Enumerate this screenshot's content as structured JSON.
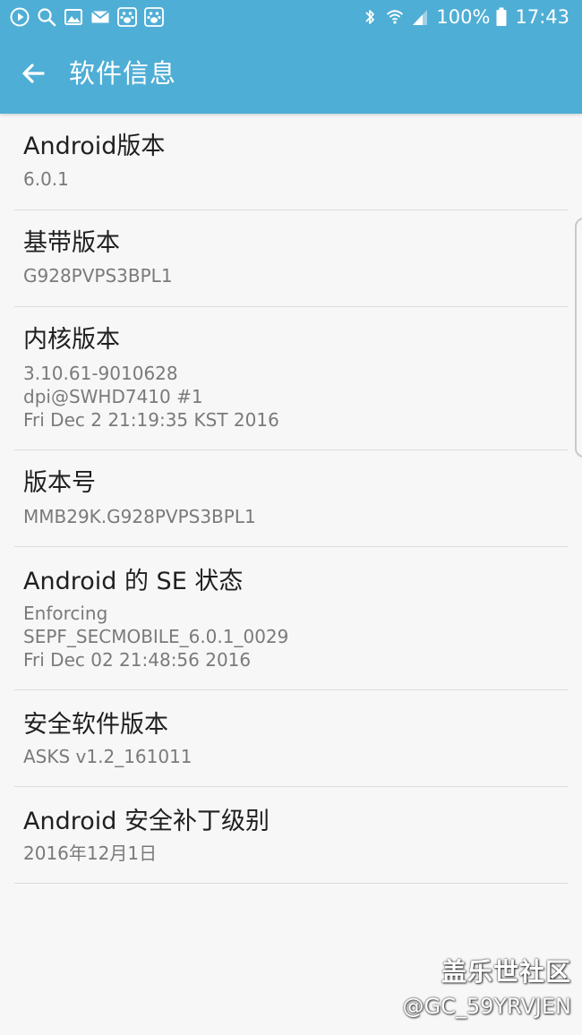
{
  "status_bar": {
    "battery": "100%",
    "time": "17:43",
    "left_icons": [
      "play-notification-icon",
      "search-notification-icon",
      "gallery-notification-icon",
      "mail-notification-icon",
      "baidu-paw-notification-icon",
      "baidu-paw-notification-icon"
    ],
    "right_icons": [
      "bluetooth-icon",
      "wifi-icon",
      "signal-icon",
      "battery-icon"
    ]
  },
  "app_bar": {
    "title": "软件信息",
    "background": "#4faed5"
  },
  "items": [
    {
      "title": "Android版本",
      "lines": [
        "6.0.1"
      ]
    },
    {
      "title": "基带版本",
      "lines": [
        "G928PVPS3BPL1"
      ]
    },
    {
      "title": "内核版本",
      "lines": [
        "3.10.61-9010628",
        "dpi@SWHD7410 #1",
        "Fri Dec 2 21:19:35 KST 2016"
      ]
    },
    {
      "title": "版本号",
      "lines": [
        "MMB29K.G928PVPS3BPL1"
      ]
    },
    {
      "title": "Android 的 SE 状态",
      "lines": [
        "Enforcing",
        "SEPF_SECMOBILE_6.0.1_0029",
        "Fri Dec 02 21:48:56 2016"
      ]
    },
    {
      "title": "安全软件版本",
      "lines": [
        "ASKS v1.2_161011"
      ]
    },
    {
      "title": "Android 安全补丁级别",
      "lines": [
        "2016年12月1日"
      ]
    }
  ],
  "watermark": {
    "brand": "盖乐世社区",
    "user": "@GC_59YRVJEN"
  }
}
